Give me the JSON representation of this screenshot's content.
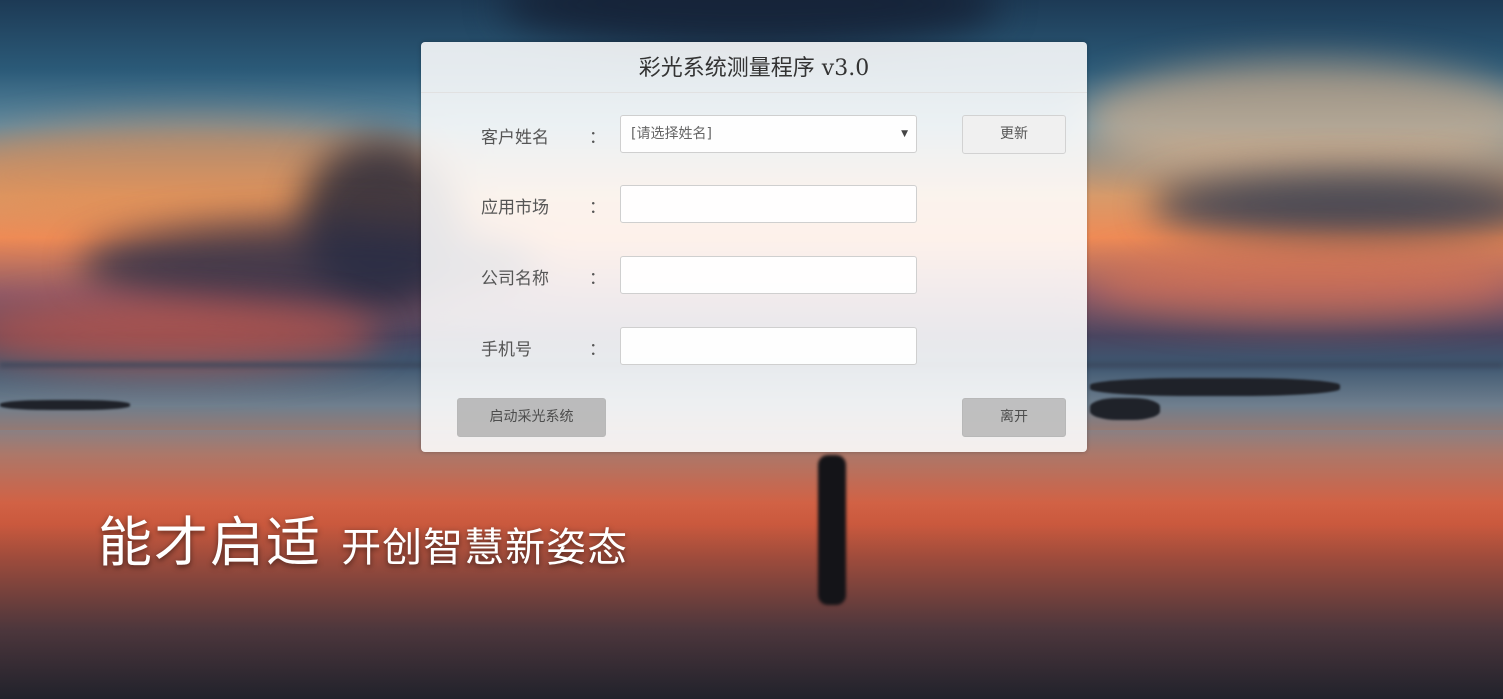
{
  "panel": {
    "title": "彩光系统测量程序 v3.0"
  },
  "form": {
    "customer_name": {
      "label": "客户姓名",
      "colon": "：",
      "selected": "[请选择姓名]"
    },
    "market": {
      "label": "应用市场",
      "colon": "：",
      "value": ""
    },
    "company": {
      "label": "公司名称",
      "colon": "：",
      "value": ""
    },
    "phone": {
      "label": "手机号",
      "colon": "：",
      "value": ""
    }
  },
  "buttons": {
    "update": "更新",
    "start": "启动采光系统",
    "leave": "离开"
  },
  "slogan": {
    "main": "能才启适",
    "sub": "开创智慧新姿态"
  },
  "icons": {
    "select_caret": "caret-down-icon"
  }
}
